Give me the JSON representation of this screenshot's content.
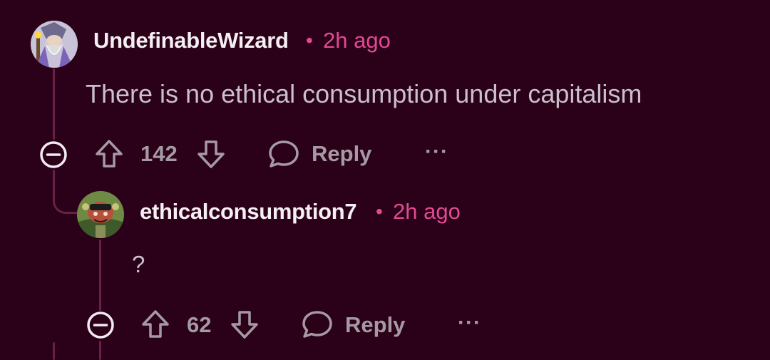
{
  "comments": [
    {
      "username": "UndefinableWizard",
      "time": "2h ago",
      "separator": "•",
      "text": "There is no ethical consumption under capitalism",
      "votes": "142",
      "reply_label": "Reply",
      "more_label": "···",
      "avatar_icon": "wizard-avatar"
    },
    {
      "username": "ethicalconsumption7",
      "time": "2h ago",
      "separator": "•",
      "text": "?",
      "votes": "62",
      "reply_label": "Reply",
      "more_label": "···",
      "avatar_icon": "snoo-avatar"
    }
  ],
  "colors": {
    "background": "#2b0019",
    "accent": "#e24a94",
    "thread_line": "#6a1f49",
    "muted_text": "#a59aa4"
  }
}
